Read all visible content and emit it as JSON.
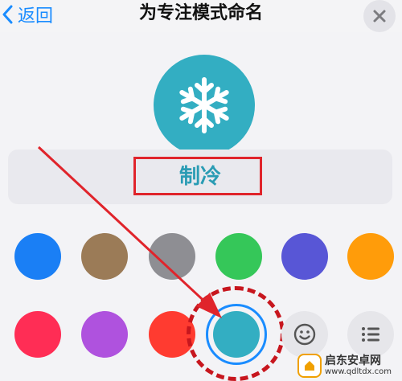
{
  "header": {
    "back_label": "返回",
    "title": "为专注模式命名"
  },
  "mode": {
    "icon": "snowflake-icon",
    "icon_color": "#33aec2",
    "name": "制冷"
  },
  "colors": {
    "row1": [
      "#1a7ff5",
      "#9b7b57",
      "#8e8e93",
      "#35c759",
      "#5856d6",
      "#ff9c0a"
    ],
    "row2": [
      "#ff2d55",
      "#af52de",
      "#ff3b30",
      "#33aec2"
    ],
    "selected": "#33aec2"
  },
  "tools": {
    "emoji_icon": "smiley-icon",
    "list_icon": "list-icon"
  },
  "annotation": {
    "arrow_color": "#e0242b",
    "highlight_color": "#e0242b"
  },
  "watermark": {
    "text_cn": "启东安卓网",
    "url": "www.qdltdx.com"
  }
}
